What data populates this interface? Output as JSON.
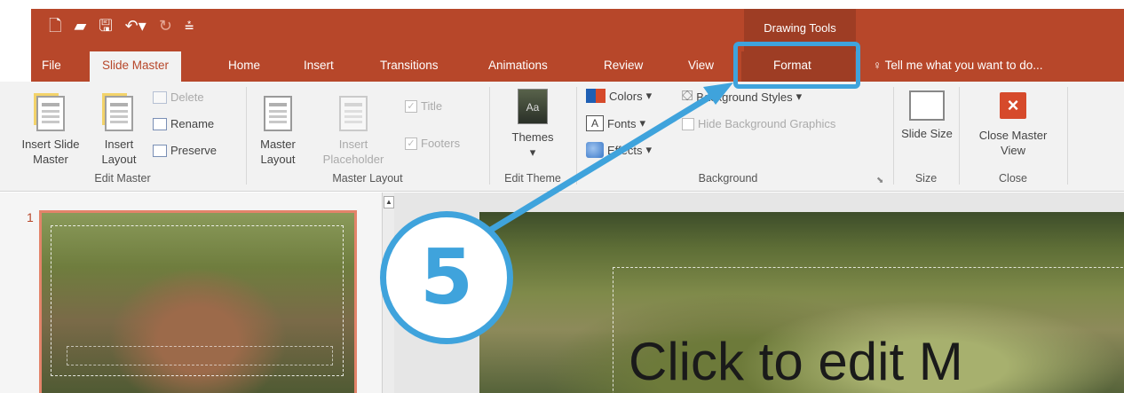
{
  "quick_access": {
    "new_icon": "new-document-icon",
    "open_icon": "open-folder-icon",
    "save_icon": "save-icon",
    "undo_icon": "undo-icon",
    "redo_icon": "redo-icon",
    "customize_icon": "customize-qat-icon"
  },
  "contextual_tab_group": "Drawing Tools",
  "tabs": {
    "file": "File",
    "slide_master": "Slide Master",
    "home": "Home",
    "insert": "Insert",
    "transitions": "Transitions",
    "animations": "Animations",
    "review": "Review",
    "view": "View",
    "format": "Format"
  },
  "tell_me": "Tell me what you want to do...",
  "ribbon": {
    "edit_master": {
      "label": "Edit Master",
      "insert_slide_master": "Insert Slide Master",
      "insert_layout": "Insert Layout",
      "delete": "Delete",
      "rename": "Rename",
      "preserve": "Preserve"
    },
    "master_layout": {
      "label": "Master Layout",
      "master_layout_btn": "Master Layout",
      "insert_placeholder": "Insert Placeholder",
      "title": "Title",
      "footers": "Footers"
    },
    "edit_theme": {
      "label": "Edit Theme",
      "themes": "Themes",
      "themes_thumb_text": "Aa"
    },
    "background": {
      "label": "Background",
      "colors": "Colors",
      "fonts": "Fonts",
      "effects": "Effects",
      "background_styles": "Background Styles",
      "hide_background_graphics": "Hide Background Graphics"
    },
    "size": {
      "label": "Size",
      "slide_size": "Slide Size"
    },
    "close": {
      "label": "Close",
      "close_master_view": "Close Master View"
    }
  },
  "thumbnails": {
    "slide_number": "1"
  },
  "slide": {
    "title_placeholder": "Click to edit M"
  },
  "annotation": {
    "step_number": "5",
    "color": "#3fa3dc"
  },
  "colors": {
    "accent": "#b7472a",
    "contextual": "#9e3d24",
    "ribbon_bg": "#f2f2f2"
  }
}
